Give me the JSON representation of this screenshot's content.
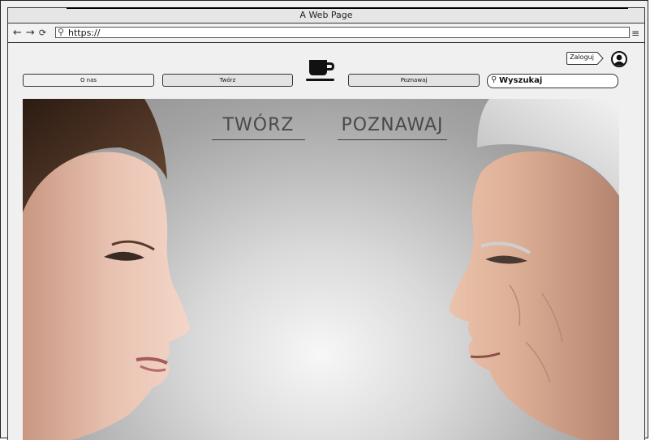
{
  "browser": {
    "title": "A Web Page",
    "url": "https://",
    "nav_icons": [
      "back-arrow-icon",
      "forward-arrow-icon",
      "reload-icon"
    ],
    "menu_icon": "hamburger-menu-icon"
  },
  "header": {
    "login_label": "Zaloguj",
    "nav": [
      {
        "label": "O nas"
      },
      {
        "label": "Twórz"
      },
      {
        "label": "Poznawaj"
      }
    ],
    "logo_icon": "coffee-cup-icon",
    "search_placeholder": "Wyszukaj"
  },
  "hero": {
    "links": [
      {
        "label": "TWÓRZ"
      },
      {
        "label": "POZNAWAJ"
      }
    ]
  }
}
